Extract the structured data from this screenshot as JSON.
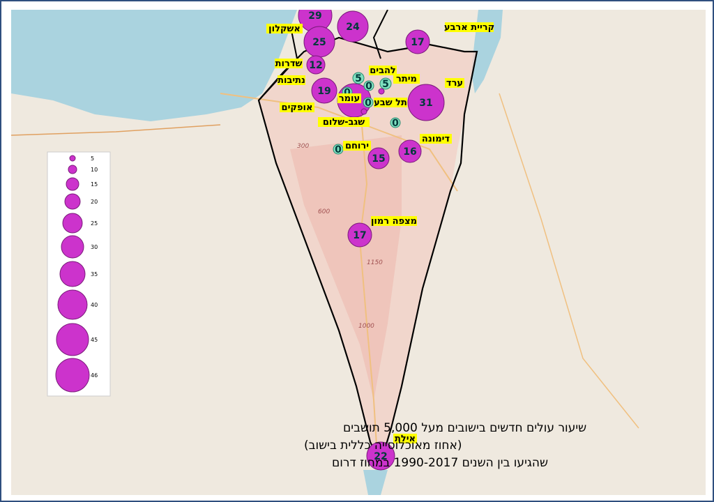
{
  "map": {
    "colors": {
      "sea": "#aad3df",
      "land": "#efe9df",
      "region_fill": "#f2cfc6",
      "bubble": "#cc33cc",
      "bubble_stroke": "#7a1a7a",
      "zero_marker": "#7fe0c0",
      "label_bg": "#ffff00",
      "border": "#000000"
    },
    "settlements": [
      {
        "name": "אשקלון",
        "value": "29"
      },
      {
        "name": "",
        "value": "24"
      },
      {
        "name": "קריית ארבע",
        "value": "17"
      },
      {
        "name": "",
        "value": "25"
      },
      {
        "name": "שדרות",
        "value": "12"
      },
      {
        "name": "נתיבות",
        "value": "19"
      },
      {
        "name": "להבים",
        "value": "5"
      },
      {
        "name": "מיתר",
        "value": "5"
      },
      {
        "name": "עומר",
        "value": "0"
      },
      {
        "name": "תל שבע",
        "value": "0"
      },
      {
        "name": "ערד",
        "value": "31"
      },
      {
        "name": "אופקים",
        "value": ""
      },
      {
        "name": "שגב-שלום",
        "value": "0"
      },
      {
        "name": "דימונה",
        "value": "16"
      },
      {
        "name": "ירוחם",
        "value": "15"
      },
      {
        "name": "מצפה רמון",
        "value": "17"
      },
      {
        "name": "אילת",
        "value": "22"
      }
    ],
    "extra_values": [
      "0",
      "5",
      "0",
      "0"
    ],
    "map_numbers": [
      "300",
      "600",
      "1150",
      "1000"
    ],
    "legend": [
      "5",
      "10",
      "15",
      "20",
      "25",
      "30",
      "35",
      "40",
      "45",
      "46"
    ],
    "title": [
      "שיעור עולים חדשים בישובים מעל 5,000 תושבים",
      "(אחוז מאוכלוסייה כללית בישוב)",
      "שהגיעו בין השנים 1990-2017 במחוז דרום"
    ]
  }
}
